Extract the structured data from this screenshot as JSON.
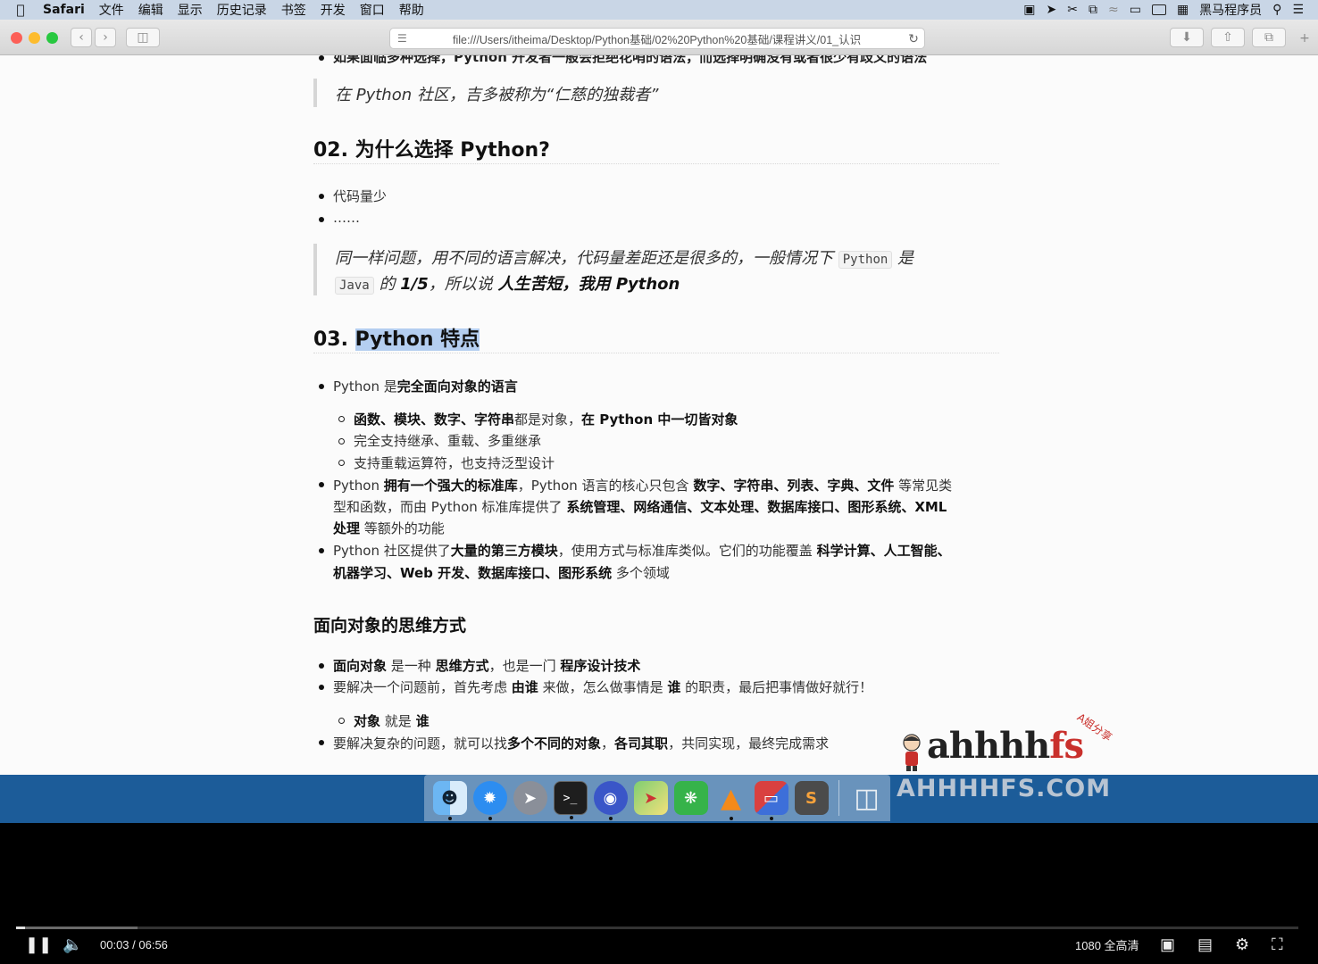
{
  "menubar": {
    "app_name": "Safari",
    "items": [
      "文件",
      "编辑",
      "显示",
      "历史记录",
      "书签",
      "开发",
      "窗口",
      "帮助"
    ],
    "user_name": "黑马程序员"
  },
  "toolbar": {
    "url": "file:///Users/itheima/Desktop/Python基础/02%20Python%20基础/课程讲义/01_认识"
  },
  "doc": {
    "top_clipped": "如果面临多种选择，Python 开发者一般会拒绝花哨的语法，而选择明确没有或者很少有歧义的语法",
    "quote1": "在 Python 社区，吉多被称为“仁慈的独裁者”",
    "h2_why": "02. 为什么选择 Python?",
    "why_items": [
      "代码量少",
      "……"
    ],
    "quote2": {
      "part1": "同一样问题，用不同的语言解决，代码量差距还是很多的，一般情况下",
      "code1": "Python",
      "part2": "是",
      "code2": "Java",
      "part3": "的",
      "bold1": "1/5",
      "part4": "，所以说",
      "bold2": "人生苦短，我用 Python"
    },
    "h2_features_num": "03.",
    "h2_features_title": "Python 特点",
    "feat1": {
      "pre": "Python 是",
      "bold": "完全面向对象的语言"
    },
    "feat1_sub": {
      "a_b1": "函数、模块、数字、字符串",
      "a_t1": "都是对象，",
      "a_b2": "在 Python 中一切皆对象",
      "b": "完全支持继承、重载、多重继承",
      "c": "支持重载运算符，也支持泛型设计"
    },
    "feat2": {
      "l1_t1": "Python ",
      "l1_b1": "拥有一个强大的标准库",
      "l1_t2": "，Python 语言的核心只包含 ",
      "l1_b2": "数字、字符串、列表、字典、文件",
      "l1_t3": " 等常见类",
      "l2_t1": "型和函数，而由 Python 标准库提供了 ",
      "l2_b1": "系统管理、网络通信、文本处理、数据库接口、图形系统、XML",
      "l3_b1": "处理",
      "l3_t1": " 等额外的功能"
    },
    "feat3": {
      "l1_t1": "Python 社区提供了",
      "l1_b1": "大量的第三方模块",
      "l1_t2": "，使用方式与标准库类似。它们的功能覆盖 ",
      "l1_b2": "科学计算、人工智能、",
      "l2_b1": "机器学习、Web 开发、数据库接口、图形系统",
      "l2_t1": " 多个领域"
    },
    "h3_oop": "面向对象的思维方式",
    "oop1": {
      "b1": "面向对象",
      "t1": " 是一种 ",
      "b2": "思维方式",
      "t2": "，也是一门 ",
      "b3": "程序设计技术"
    },
    "oop2": {
      "t1": "要解决一个问题前，首先考虑 ",
      "b1": "由谁",
      "t2": " 来做，怎么做事情是 ",
      "b2": "谁",
      "t3": " 的职责，最后把事情做好就行！"
    },
    "oop2_sub": {
      "b1": "对象",
      "t1": " 就是 ",
      "b2": "谁"
    },
    "oop3": {
      "t1": "要解决复杂的问题，就可以找",
      "b1": "多个不同的对象",
      "t2": "，",
      "b2": "各司其职",
      "t3": "，共同实现，最终完成需求"
    }
  },
  "watermark": {
    "logo_a": "a",
    "logo_h": "hhhh",
    "logo_f": "fs",
    "site": "AHHHHFS.COM",
    "tag": "A姐分享"
  },
  "player": {
    "time": "00:03 / 06:56",
    "quality": "1080 全高清",
    "progress_played": 0.007,
    "progress_buffered": 0.095
  },
  "colors": {
    "accent_selection": "#b4cef0",
    "desktop": "#1c5c99"
  }
}
